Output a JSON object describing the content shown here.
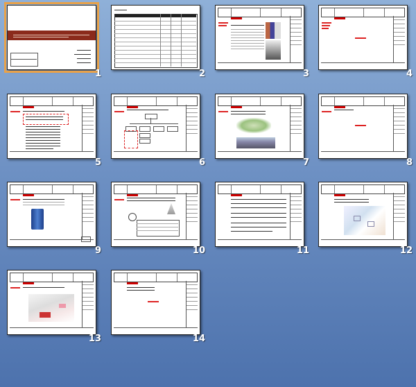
{
  "slides": [
    {
      "number": "1",
      "selected": true
    },
    {
      "number": "2",
      "selected": false
    },
    {
      "number": "3",
      "selected": false
    },
    {
      "number": "4",
      "selected": false
    },
    {
      "number": "5",
      "selected": false
    },
    {
      "number": "6",
      "selected": false
    },
    {
      "number": "7",
      "selected": false
    },
    {
      "number": "8",
      "selected": false
    },
    {
      "number": "9",
      "selected": false
    },
    {
      "number": "10",
      "selected": false
    },
    {
      "number": "11",
      "selected": false
    },
    {
      "number": "12",
      "selected": false
    },
    {
      "number": "13",
      "selected": false
    },
    {
      "number": "14",
      "selected": false
    }
  ],
  "colors": {
    "background_top": "#8fb0d8",
    "background_bottom": "#4d72ad",
    "selection": "#e8a24a",
    "title_banner": "#8b2a1b",
    "accent_red": "#cc0000"
  }
}
